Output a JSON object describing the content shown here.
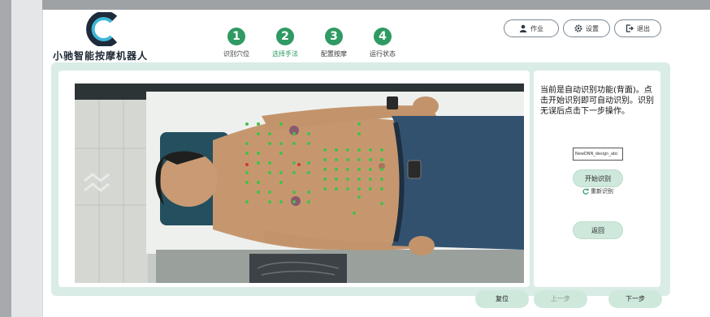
{
  "app": {
    "brand_name": "小驰智能按摩机器人"
  },
  "steps": [
    {
      "number": "1",
      "label": "识别穴位"
    },
    {
      "number": "2",
      "label": "选择手法"
    },
    {
      "number": "3",
      "label": "配置按摩"
    },
    {
      "number": "4",
      "label": "运行状态"
    }
  ],
  "header_buttons": {
    "user": "作业",
    "settings": "设置",
    "logout": "退出"
  },
  "side_panel": {
    "instructions": "当前是自动识别功能(背面)。点击开始识别即可自动识别。识别无误后点击下一步操作。",
    "model_select_value": "NewDNN_design_abc",
    "start_recognition": "开始识别",
    "refresh_label": "重新识别",
    "back": "返回"
  },
  "footer": {
    "reset": "复位",
    "prev": "上一步",
    "next": "下一步"
  },
  "colors": {
    "accent": "#2f9a63",
    "panel_bg": "#d9ece5",
    "button_bg": "#cfe8dc",
    "point_green": "#44c04a",
    "point_red": "#d9343c"
  }
}
